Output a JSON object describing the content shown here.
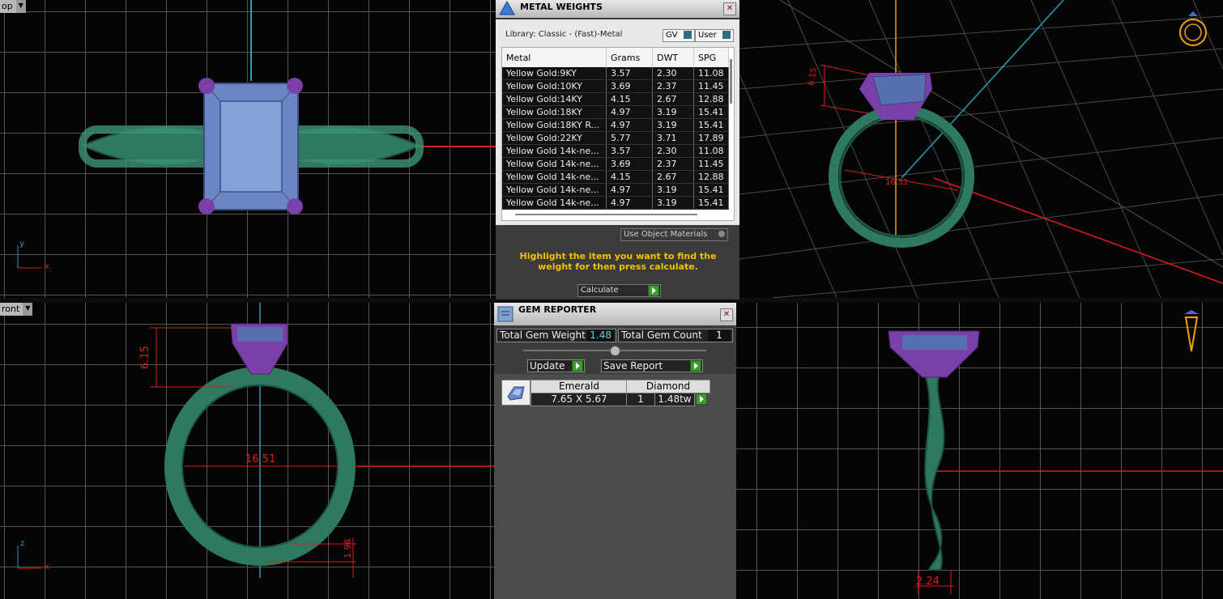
{
  "viewports": {
    "top_label": "op",
    "front_label": "ront",
    "top_axes": {
      "x": "x",
      "y": "y"
    },
    "front_axes": {
      "x": "x",
      "z": "z"
    },
    "dimensions": {
      "prong_height": "6.15",
      "ring_inner_diameter": "16.51",
      "band_thickness": "1.98",
      "band_width": "2.24",
      "persp_height": "6.15",
      "persp_diameter": "16.51"
    }
  },
  "metal_weights": {
    "title": "METAL WEIGHTS",
    "library": "Library: Classic - (Fast)-Metal",
    "gv_label": "GV",
    "user_label": "User",
    "columns": [
      "Metal",
      "Grams",
      "DWT",
      "SPG"
    ],
    "rows": [
      [
        "Yellow Gold:9KY",
        "3.57",
        "2.30",
        "11.08"
      ],
      [
        "Yellow Gold:10KY",
        "3.69",
        "2.37",
        "11.45"
      ],
      [
        "Yellow Gold:14KY",
        "4.15",
        "2.67",
        "12.88"
      ],
      [
        "Yellow Gold:18KY",
        "4.97",
        "3.19",
        "15.41"
      ],
      [
        "Yellow Gold:18KY R...",
        "4.97",
        "3.19",
        "15.41"
      ],
      [
        "Yellow Gold:22KY",
        "5.77",
        "3.71",
        "17.89"
      ],
      [
        "Yellow Gold 14k-ne...",
        "3.57",
        "2.30",
        "11.08"
      ],
      [
        "Yellow Gold 14k-ne...",
        "3.69",
        "2.37",
        "11.45"
      ],
      [
        "Yellow Gold 14k-ne...",
        "4.15",
        "2.67",
        "12.88"
      ],
      [
        "Yellow Gold 14k-ne...",
        "4.97",
        "3.19",
        "15.41"
      ],
      [
        "Yellow Gold 14k-ne...",
        "4.97",
        "3.19",
        "15.41"
      ]
    ],
    "use_object_materials": "Use Object Materials",
    "hint": "Highlight the item you want to find the weight for then press calculate.",
    "calculate": "Calculate"
  },
  "gem_reporter": {
    "title": "GEM REPORTER",
    "total_weight_label": "Total Gem Weight",
    "total_weight": "1.48",
    "total_count_label": "Total Gem Count",
    "total_count": "1",
    "update": "Update",
    "save_report": "Save Report",
    "gem": {
      "name": "Emerald",
      "size": "7.65 X 5.67",
      "type": "Diamond",
      "count": "1",
      "weight": "1.48tw"
    }
  },
  "colors": {
    "band": "#2f7a5e",
    "stone": "#6c86c4",
    "prong": "#7a3fa8",
    "dim": "#dd1c1c",
    "axis": "#26a0b4",
    "hint": "#f2c200"
  }
}
